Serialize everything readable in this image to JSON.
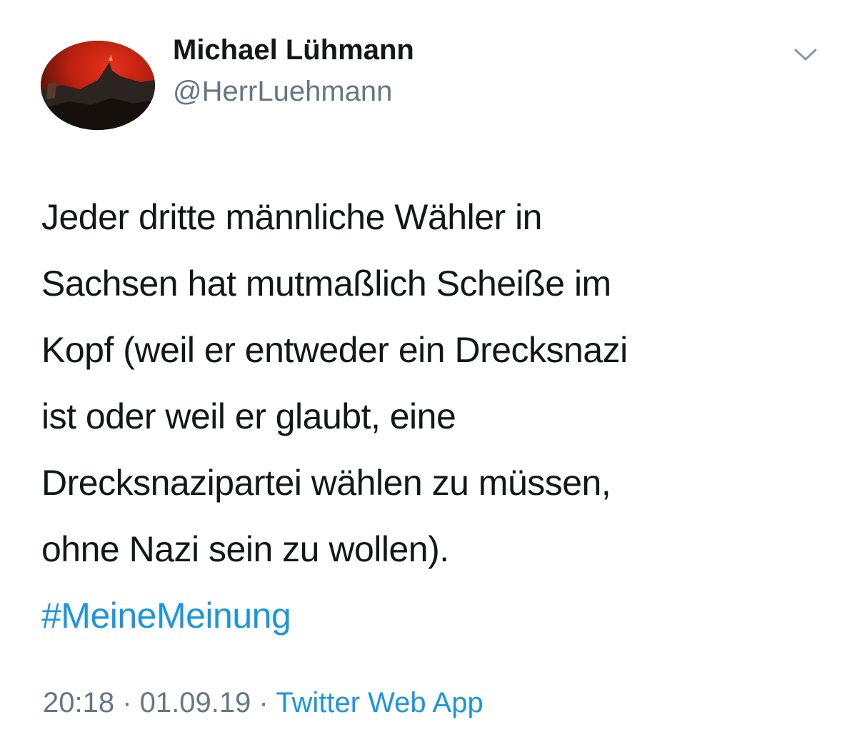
{
  "author": {
    "name": "Michael Lühmann",
    "handle": "@HerrLuehmann",
    "avatar_icon": "avatar-photo"
  },
  "tweet": {
    "lines": [
      "Jeder dritte männliche Wähler in",
      "Sachsen hat mutmaßlich Scheiße im",
      "Kopf (weil er entweder ein Drecksnazi",
      "ist oder weil er glaubt, eine",
      "Drecksnazipartei wählen zu müssen,",
      "ohne Nazi sein zu wollen)."
    ],
    "hashtag": "#MeineMeinung"
  },
  "meta": {
    "time": "20:18",
    "date": "01.09.19",
    "separator": "·",
    "source": "Twitter Web App"
  },
  "menu": {
    "icon": "chevron-down-icon"
  },
  "colors": {
    "text": "#14171a",
    "secondary": "#657786",
    "link": "#1b95e0"
  }
}
